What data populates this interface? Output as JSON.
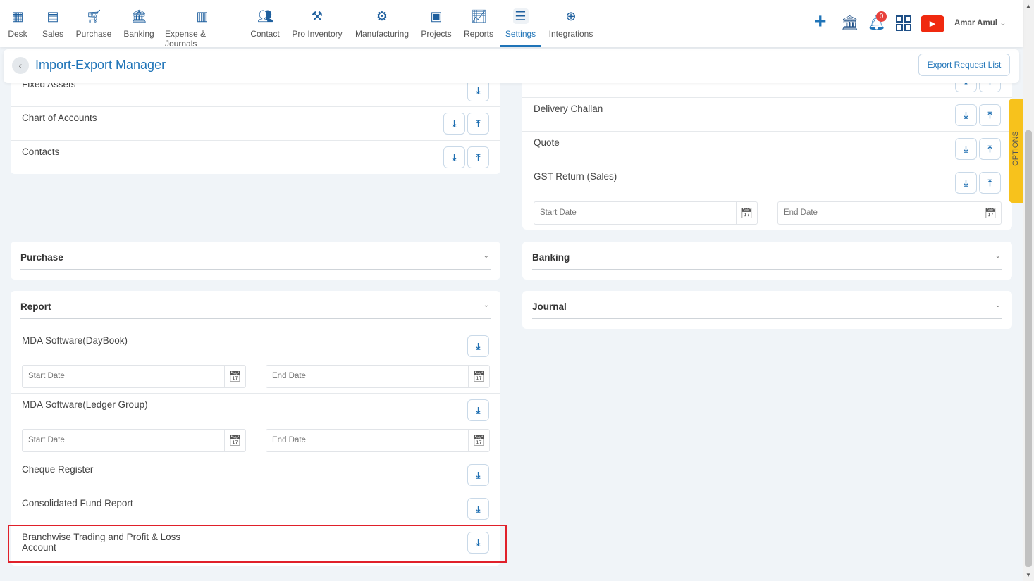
{
  "nav": [
    {
      "label": "Desk",
      "icon": "desk-icon"
    },
    {
      "label": "Sales",
      "icon": "sales-icon"
    },
    {
      "label": "Purchase",
      "icon": "cart-icon"
    },
    {
      "label": "Banking",
      "icon": "bank-icon"
    },
    {
      "label": "Expense & Journals",
      "icon": "journal-icon"
    },
    {
      "label": "Contact",
      "icon": "contact-icon"
    },
    {
      "label": "Pro Inventory",
      "icon": "inventory-icon"
    },
    {
      "label": "Manufacturing",
      "icon": "manufacturing-icon"
    },
    {
      "label": "Projects",
      "icon": "projects-icon"
    },
    {
      "label": "Reports",
      "icon": "reports-icon"
    },
    {
      "label": "Settings",
      "icon": "settings-icon",
      "active": true
    },
    {
      "label": "Integrations",
      "icon": "integrations-icon"
    }
  ],
  "topright": {
    "notifications": "0",
    "user": "Amar Amul"
  },
  "header": {
    "title": "Import-Export Manager",
    "export_button": "Export Request List"
  },
  "left_top": [
    "Fixed Assets",
    "Chart of Accounts",
    "Contacts"
  ],
  "right_top": [
    "Delivery Challan",
    "Quote",
    "GST Return (Sales)"
  ],
  "sections": {
    "purchase": "Purchase",
    "report": "Report",
    "banking": "Banking",
    "journal": "Journal"
  },
  "report_rows": [
    "MDA Software(DayBook)",
    "MDA Software(Ledger Group)",
    "Cheque Register",
    "Consolidated Fund Report",
    "Branchwise Trading and Profit & Loss Account"
  ],
  "date": {
    "start": "Start Date",
    "end": "End Date"
  },
  "options": "OPTIONS",
  "colors": {
    "accent": "#1f74b8",
    "highlight": "#e0202a",
    "options_tab": "#f7c21c"
  }
}
